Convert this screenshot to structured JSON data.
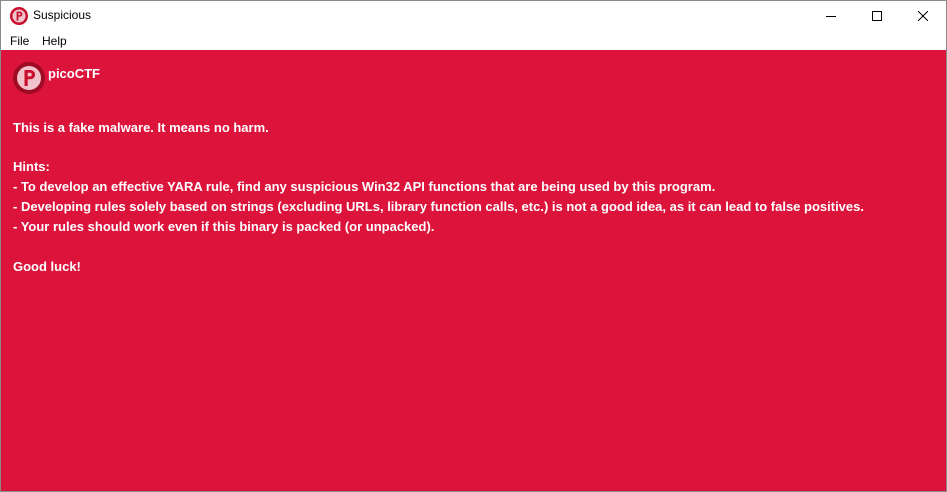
{
  "window": {
    "title": "Suspicious",
    "app_icon": "picoctf-logo-icon",
    "controls": {
      "minimize_icon": "minimize-icon",
      "maximize_icon": "maximize-icon",
      "close_icon": "close-icon"
    }
  },
  "menubar": {
    "file_label": "File",
    "help_label": "Help"
  },
  "content": {
    "background_color": "#dc143c",
    "text_color": "#ffffff",
    "logo_text": "picoCTF",
    "message": "This is a fake malware. It means no harm.",
    "hints_heading": "Hints:",
    "hints": [
      "- To develop an effective YARA rule, find any suspicious Win32 API functions that are being used by this program.",
      "- Developing rules solely based on strings (excluding URLs, library function calls, etc.) is not a good idea, as it can lead to false positives.",
      "- Your rules should work even if this binary is packed (or unpacked)."
    ],
    "closing": "Good luck!"
  }
}
